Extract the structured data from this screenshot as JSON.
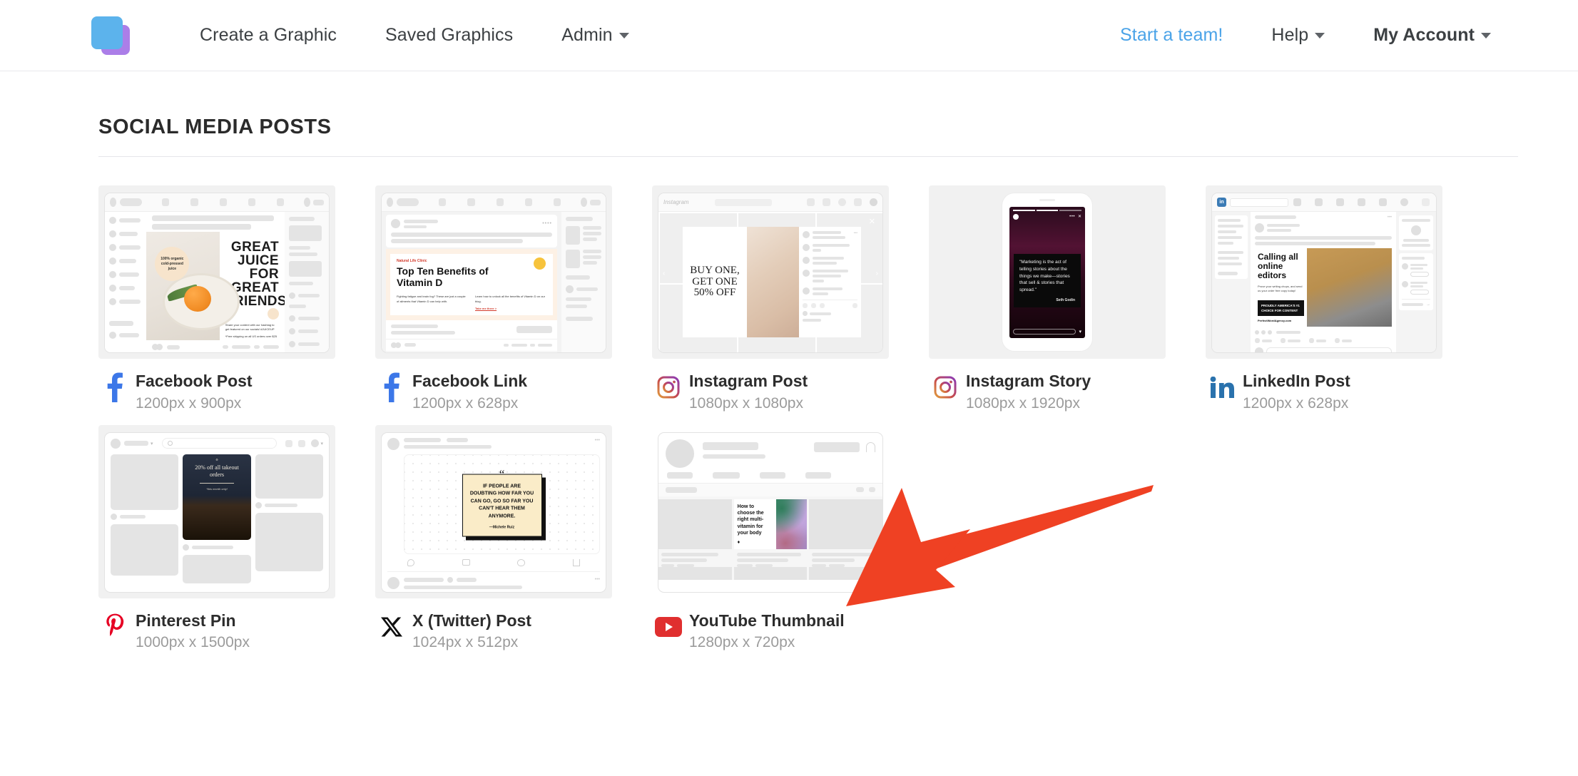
{
  "navbar": {
    "logo_name": "app-logo",
    "left_items": [
      {
        "label": "Create a Graphic",
        "has_caret": false
      },
      {
        "label": "Saved Graphics",
        "has_caret": false
      },
      {
        "label": "Admin",
        "has_caret": true
      }
    ],
    "right_items": [
      {
        "label": "Start a team!",
        "has_caret": false,
        "accent": true
      },
      {
        "label": "Help",
        "has_caret": true,
        "accent": false
      },
      {
        "label": "My Account",
        "has_caret": true,
        "accent": false
      }
    ]
  },
  "page": {
    "section_title": "SOCIAL MEDIA POSTS"
  },
  "cards": [
    {
      "name": "Facebook Post",
      "dims": "1200px x 900px",
      "icon": "facebook-icon",
      "icon_color": "#3c77e8"
    },
    {
      "name": "Facebook Link",
      "dims": "1200px x 628px",
      "icon": "facebook-icon",
      "icon_color": "#3c77e8"
    },
    {
      "name": "Instagram Post",
      "dims": "1080px x 1080px",
      "icon": "instagram-icon",
      "icon_color": "#c13584"
    },
    {
      "name": "Instagram Story",
      "dims": "1080px x 1920px",
      "icon": "instagram-icon",
      "icon_color": "#c13584"
    },
    {
      "name": "LinkedIn Post",
      "dims": "1200px x 628px",
      "icon": "linkedin-icon",
      "icon_color": "#2a72ad"
    },
    {
      "name": "Pinterest Pin",
      "dims": "1000px x 1500px",
      "icon": "pinterest-icon",
      "icon_color": "#e60023"
    },
    {
      "name": "X (Twitter) Post",
      "dims": "1024px x 512px",
      "icon": "x-twitter-icon",
      "icon_color": "#0f0f0f"
    },
    {
      "name": "YouTube Thumbnail",
      "dims": "1280px x 720px",
      "icon": "youtube-icon",
      "icon_color": "#e02f2f"
    }
  ],
  "thumbnails": {
    "facebook_post": {
      "headline": "GREAT JUICE FOR GREAT FRIENDS",
      "badge": "100% organic cold-pressed juice",
      "caption_1": "Share your content with our hashtag to get featured on our socials! #JUICEUP",
      "caption_2": "*Free shipping on all US orders over $25"
    },
    "facebook_link": {
      "eyebrow": "Natural Life Clinic",
      "headline": "Top Ten Benefits of Vitamin D",
      "body_left": "Fighting fatigue and brain fog? These are just a couple of ailments that Vitamin D can help with.",
      "body_right": "Learn how to unlock all the benefits of Vitamin D on our blog.",
      "link": "Take me there >"
    },
    "instagram_post": {
      "headline": "BUY ONE, GET ONE 50% OFF",
      "brand": "Instagram"
    },
    "instagram_story": {
      "quote": "\"Marketing is the act of telling stories about the things we make—stories that sell & stories that spread.\"",
      "attribution": "Seth Godin"
    },
    "linkedin_post": {
      "headline": "Calling all online editors",
      "body": "Prove your writing chops, and send us your order free copy today!",
      "banner": "PROUDLY AMERICA'S #1 CHOICE FOR CONTENT",
      "footer": "PerfectWordAgency.com"
    },
    "pinterest_pin": {
      "headline": "20% off all takeout orders",
      "subtext": "*this month only!"
    },
    "x_post": {
      "quote": "IF PEOPLE ARE DOUBTING HOW FAR YOU CAN GO, GO SO FAR YOU CAN'T HEAR THEM ANYMORE.",
      "attribution": "—Michele Ruiz"
    },
    "youtube_thumbnail": {
      "headline": "How to choose the right multi-vitamin for your body"
    }
  },
  "annotation": {
    "name": "red-arrow-pointer",
    "color": "#ef4123",
    "points_to": "YouTube Thumbnail"
  }
}
